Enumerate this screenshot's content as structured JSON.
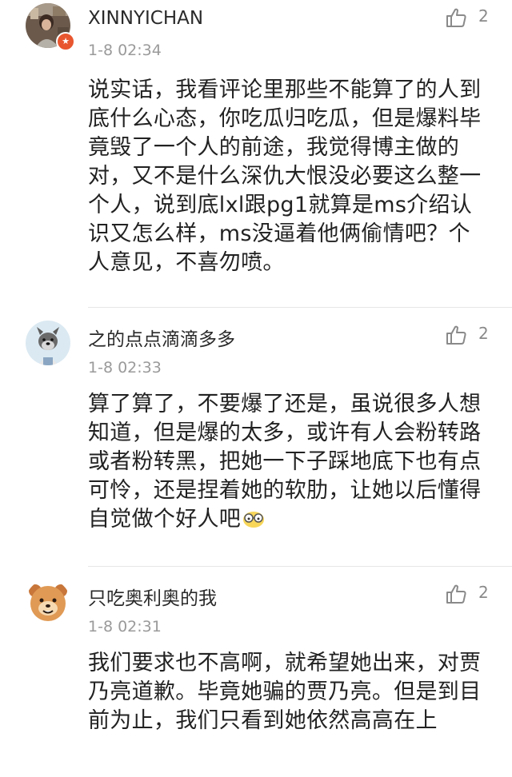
{
  "comments": [
    {
      "username": "XINNYICHAN",
      "timestamp": "1-8 02:34",
      "likes": "2",
      "avatar_icon": "user-photo-avatar",
      "badge_icon": "star-badge-icon",
      "text": "说实话，我看评论里那些不能算了的人到底什么心态，你吃瓜归吃瓜，但是爆料毕竟毁了一个人的前途，我觉得博主做的对，又不是什么深仇大恨没必要这么整一个人，说到底lxl跟pg1就算是ms介绍认识又怎么样，ms没逼着他俩偷情吧？个人意见，不喜勿喷。"
    },
    {
      "username": "之的点点滴滴多多",
      "timestamp": "1-8 02:33",
      "likes": "2",
      "avatar_icon": "dog-avatar",
      "text": "算了算了，不要爆了还是，虽说很多人想知道，但是爆的太多，或许有人会粉转路或者粉转黑，把她一下子踩地底下也有点可怜，还是捏着她的软肋，让她以后懂得自觉做个好人吧",
      "emoji_icon": "glasses-face-emoji-icon"
    },
    {
      "username": "只吃奥利奥的我",
      "timestamp": "1-8 02:31",
      "likes": "2",
      "avatar_icon": "cartoon-bear-avatar",
      "text": "我们要求也不高啊，就希望她出来，对贾乃亮道歉。毕竟她骗的贾乃亮。但是到目前为止，我们只看到她依然高高在上"
    }
  ],
  "colors": {
    "username": "#2a2a2a",
    "timestamp": "#9a9a9a",
    "body": "#222222",
    "like": "#8a8a8a",
    "badge": "#e8562f",
    "divider": "#e6e6e6"
  },
  "like_icon": "thumbs-up-icon"
}
